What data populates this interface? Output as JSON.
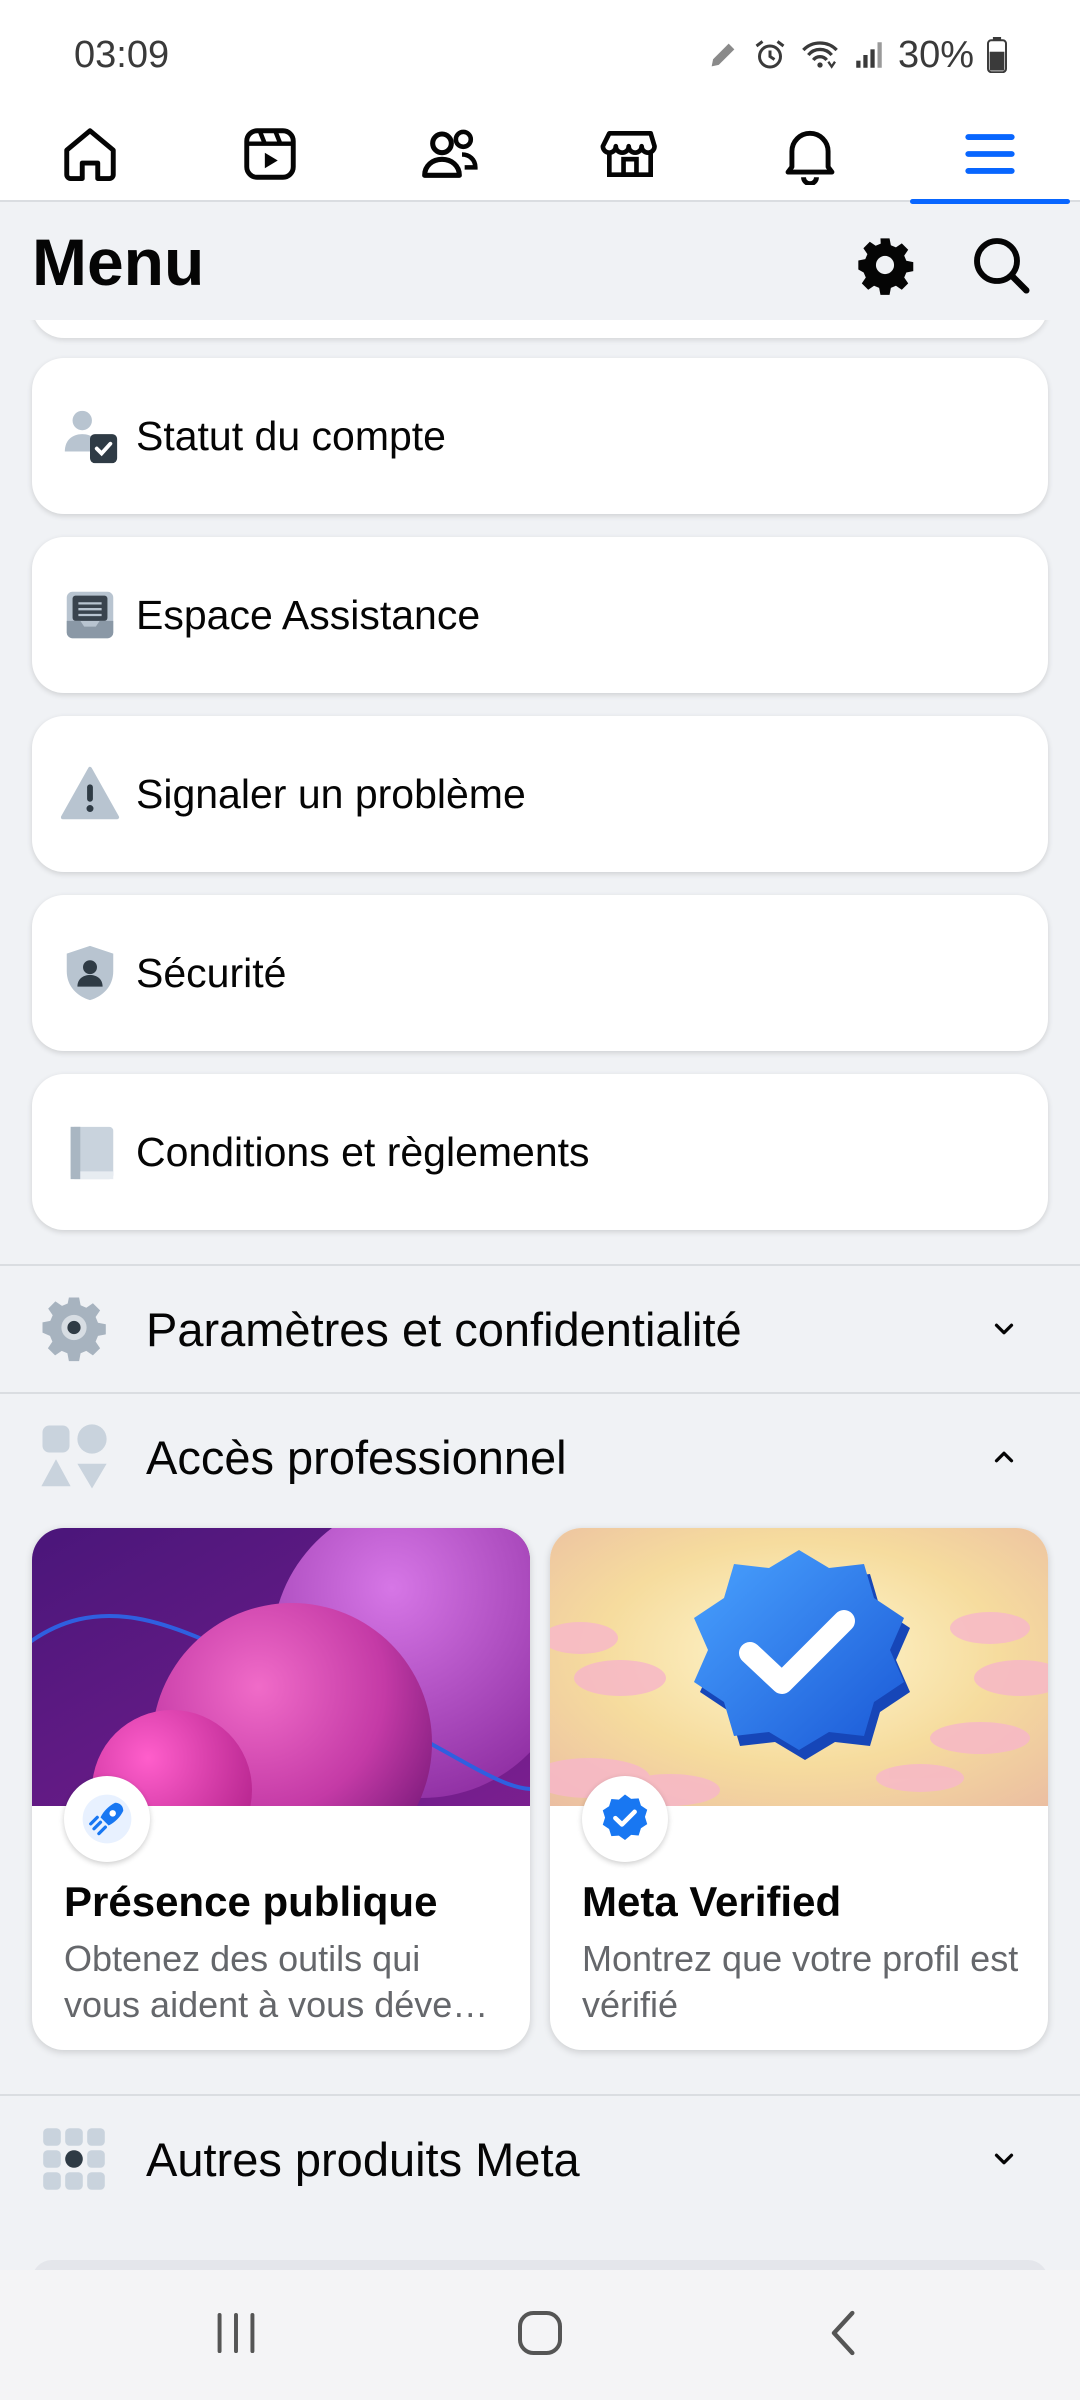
{
  "status_bar": {
    "time": "03:09",
    "battery": "30%",
    "icons": [
      "pencil-icon",
      "alarm-icon",
      "wifi-icon",
      "signal-icon",
      "battery-icon"
    ]
  },
  "nav": {
    "tabs": [
      {
        "icon": "home-icon",
        "active": false
      },
      {
        "icon": "video-icon",
        "active": false
      },
      {
        "icon": "friends-icon",
        "active": false
      },
      {
        "icon": "marketplace-icon",
        "active": false
      },
      {
        "icon": "bell-icon",
        "active": false
      },
      {
        "icon": "menu-icon",
        "active": true
      }
    ],
    "accent_color": "#0866ff"
  },
  "header": {
    "title": "Menu",
    "icons": [
      "settings-gear-icon",
      "search-icon"
    ]
  },
  "cards": [
    {
      "label": "Statut du compte",
      "icon": "account-status-icon"
    },
    {
      "label": "Espace Assistance",
      "icon": "support-inbox-icon"
    },
    {
      "label": "Signaler un problème",
      "icon": "warning-icon"
    },
    {
      "label": "Sécurité",
      "icon": "shield-icon"
    },
    {
      "label": "Conditions et règlements",
      "icon": "book-icon"
    }
  ],
  "sections": {
    "settings": {
      "label": "Paramètres et confidentialité",
      "icon": "gear-icon",
      "expanded": false
    },
    "pro": {
      "label": "Accès professionnel",
      "icon": "shapes-icon",
      "expanded": true
    },
    "meta": {
      "label": "Autres produits Meta",
      "icon": "grid-icon",
      "expanded": false
    }
  },
  "promos": [
    {
      "title": "Présence publique",
      "desc": "Obtenez des outils qui vous aident à vous déve…",
      "badge": "rocket-icon"
    },
    {
      "title": "Meta Verified",
      "desc": "Montrez que votre profil est vérifié",
      "badge": "verified-icon"
    }
  ]
}
